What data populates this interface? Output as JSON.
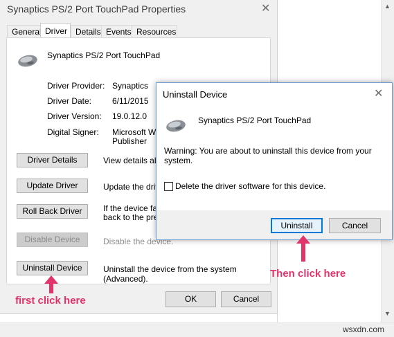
{
  "props": {
    "title": "Synaptics PS/2 Port TouchPad Properties",
    "tabs": [
      "General",
      "Driver",
      "Details",
      "Events",
      "Resources"
    ],
    "device_name": "Synaptics PS/2 Port TouchPad",
    "provider_label": "Driver Provider:",
    "provider_value": "Synaptics",
    "date_label": "Driver Date:",
    "date_value": "6/11/2015",
    "version_label": "Driver Version:",
    "version_value": "19.0.12.0",
    "signer_label": "Digital Signer:",
    "signer_value_1": "Microsoft Win",
    "signer_value_2": "Publisher",
    "buttons": {
      "details": "Driver Details",
      "update": "Update Driver",
      "rollback": "Roll Back Driver",
      "disable": "Disable Device",
      "uninstall": "Uninstall Device"
    },
    "desc": {
      "details": "View details abo",
      "update": "Update the drive",
      "rollback_1": "If the device fails",
      "rollback_2": "back to the prev",
      "disable": "Disable the device.",
      "uninstall": "Uninstall the device from the system (Advanced)."
    },
    "ok": "OK",
    "cancel": "Cancel"
  },
  "modal": {
    "title": "Uninstall Device",
    "device_name": "Synaptics PS/2 Port TouchPad",
    "warning": "Warning: You are about to uninstall this device from your system.",
    "checkbox_label": "Delete the driver software for this device.",
    "checkbox_checked": false,
    "uninstall": "Uninstall",
    "cancel": "Cancel"
  },
  "annotations": {
    "first": "first click here",
    "then": "Then click here"
  },
  "watermark": "wsxdn.com",
  "colors": {
    "annotation": "#e0346a",
    "focus_border": "#0078d7"
  },
  "icons": {
    "close": "close-icon",
    "device": "touchpad-mouse-icon",
    "arrow": "up-arrow-icon"
  }
}
